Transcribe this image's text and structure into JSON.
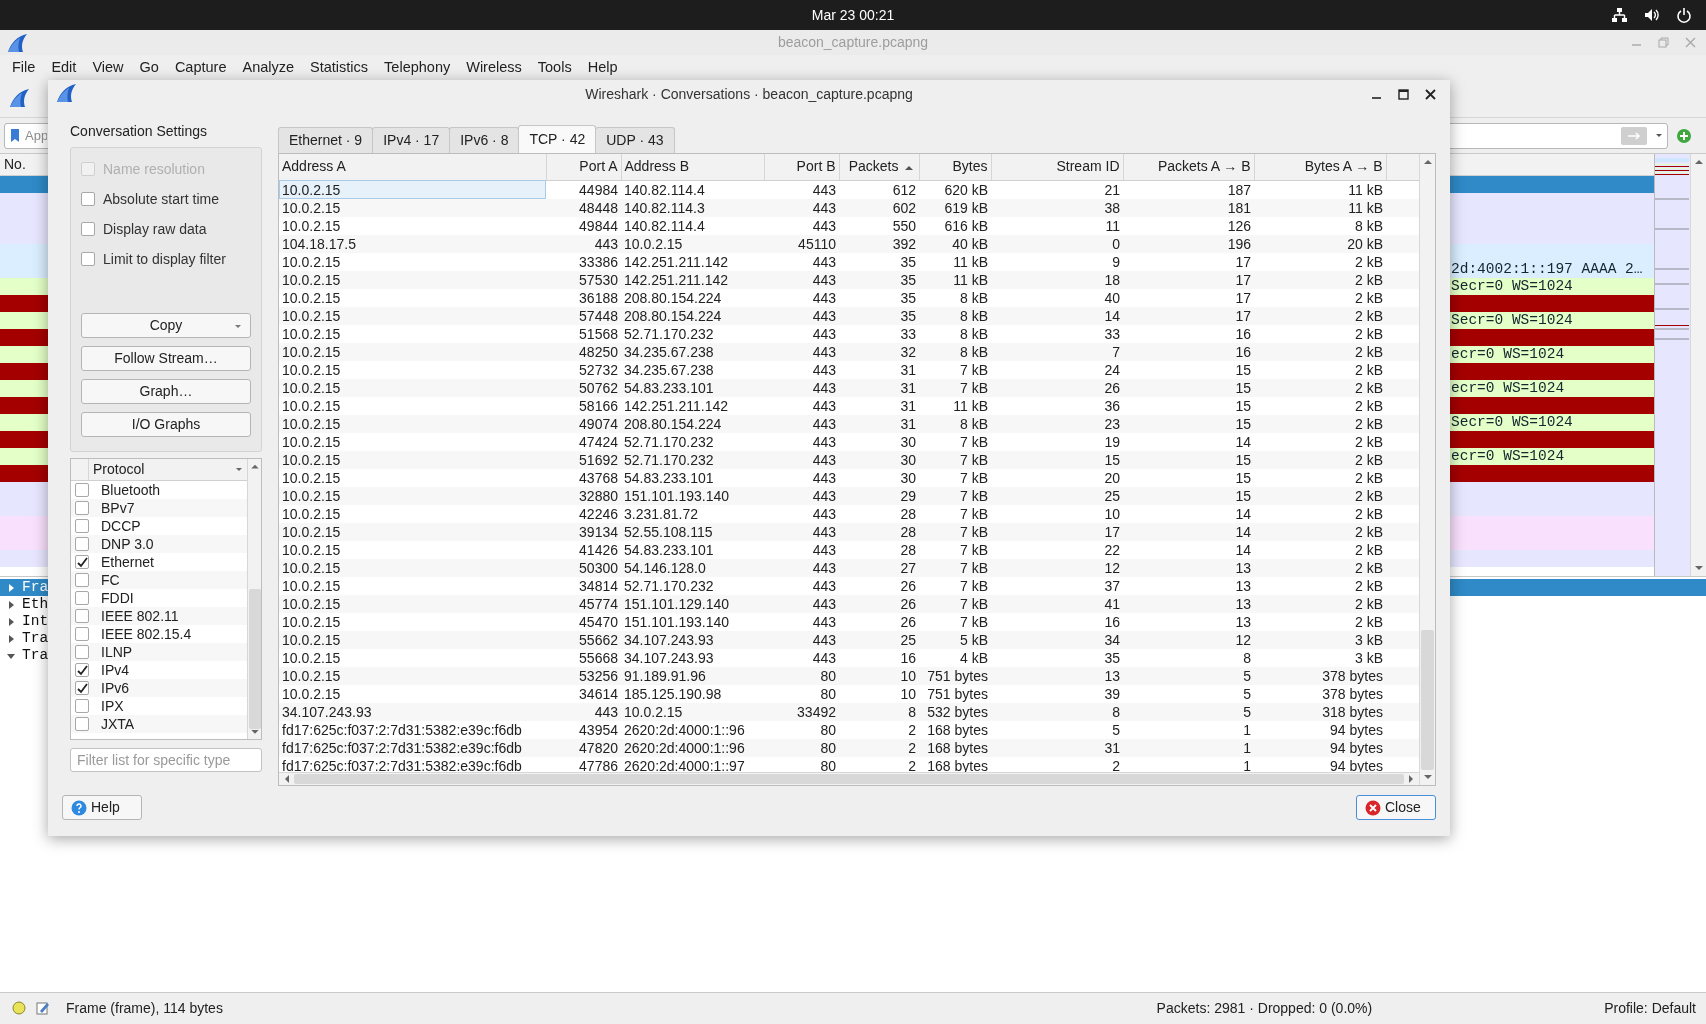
{
  "system_bar": {
    "clock": "Mar 23  00:21"
  },
  "main_window": {
    "title": "beacon_capture.pcapng",
    "menu": [
      "File",
      "Edit",
      "View",
      "Go",
      "Capture",
      "Analyze",
      "Statistics",
      "Telephony",
      "Wireless",
      "Tools",
      "Help"
    ],
    "filter": {
      "placeholder": "App"
    },
    "packet_list": {
      "column_1": "No.",
      "rows": [
        {
          "selected": true
        },
        {
          "selected": false,
          "color": "#e7e6ff"
        },
        {
          "selected": false,
          "color": "#e7e6ff"
        },
        {
          "selected": false,
          "color": "#e7e6ff"
        },
        {
          "selected": false,
          "color": "#daeeff"
        },
        {
          "selected": false,
          "color": "#daeeff",
          "text": "2d:4002:1::197 AAAA 2…"
        },
        {
          "selected": false,
          "color": "#e4ffc7",
          "text": "Secr=0 WS=1024"
        },
        {
          "selected": false,
          "color": "#a40000"
        },
        {
          "selected": false,
          "color": "#e4ffc7",
          "text": "Secr=0 WS=1024"
        },
        {
          "selected": false,
          "color": "#a40000"
        },
        {
          "selected": false,
          "color": "#e4ffc7",
          "text": "ecr=0 WS=1024"
        },
        {
          "selected": false,
          "color": "#a40000"
        },
        {
          "selected": false,
          "color": "#e4ffc7",
          "text": "ecr=0 WS=1024"
        },
        {
          "selected": false,
          "color": "#a40000"
        },
        {
          "selected": false,
          "color": "#e4ffc7",
          "text": "Secr=0 WS=1024"
        },
        {
          "selected": false,
          "color": "#a40000"
        },
        {
          "selected": false,
          "color": "#e4ffc7",
          "text": "ecr=0 WS=1024"
        },
        {
          "selected": false,
          "color": "#a40000"
        },
        {
          "selected": false,
          "color": "#e7e6ff"
        },
        {
          "selected": false,
          "color": "#e7e6ff"
        },
        {
          "selected": false,
          "color": "#f9e0fc"
        },
        {
          "selected": false,
          "color": "#f9e0fc"
        },
        {
          "selected": false,
          "color": "#e7e6ff"
        }
      ]
    },
    "details": [
      {
        "label": "Fra",
        "selected": true,
        "expanded": false
      },
      {
        "label": "Eth",
        "selected": false,
        "expanded": false
      },
      {
        "label": "Int",
        "selected": false,
        "expanded": false
      },
      {
        "label": "Tra",
        "selected": false,
        "expanded": false
      },
      {
        "label": "Tra",
        "selected": false,
        "expanded": true
      }
    ]
  },
  "dialog": {
    "title": "Wireshark · Conversations · beacon_capture.pcapng",
    "settings_title": "Conversation Settings",
    "options": [
      {
        "label": "Name resolution",
        "checked": false,
        "disabled": true
      },
      {
        "label": "Absolute start time",
        "checked": false,
        "disabled": false
      },
      {
        "label": "Display raw data",
        "checked": false,
        "disabled": false
      },
      {
        "label": "Limit to display filter",
        "checked": false,
        "disabled": false
      }
    ],
    "buttons": [
      {
        "label": "Copy",
        "kind": "menu"
      },
      {
        "label": "Follow Stream…",
        "kind": "plain"
      },
      {
        "label": "Graph…",
        "kind": "plain"
      },
      {
        "label": "I/O Graphs",
        "kind": "plain"
      }
    ],
    "protocol_header": "Protocol",
    "protocols": [
      {
        "label": "Bluetooth",
        "checked": false
      },
      {
        "label": "BPv7",
        "checked": false
      },
      {
        "label": "DCCP",
        "checked": false
      },
      {
        "label": "DNP 3.0",
        "checked": false
      },
      {
        "label": "Ethernet",
        "checked": true
      },
      {
        "label": "FC",
        "checked": false
      },
      {
        "label": "FDDI",
        "checked": false
      },
      {
        "label": "IEEE 802.11",
        "checked": false
      },
      {
        "label": "IEEE 802.15.4",
        "checked": false
      },
      {
        "label": "ILNP",
        "checked": false
      },
      {
        "label": "IPv4",
        "checked": true
      },
      {
        "label": "IPv6",
        "checked": true
      },
      {
        "label": "IPX",
        "checked": false
      },
      {
        "label": "JXTA",
        "checked": false
      }
    ],
    "filter_placeholder": "Filter list for specific type",
    "tabs": [
      {
        "label": "Ethernet · 9",
        "selected": false
      },
      {
        "label": "IPv4 · 17",
        "selected": false
      },
      {
        "label": "IPv6 · 8",
        "selected": false
      },
      {
        "label": "TCP · 42",
        "selected": true
      },
      {
        "label": "UDP · 43",
        "selected": false
      }
    ],
    "table": {
      "columns": [
        {
          "label": "Address A",
          "kind": "address",
          "sorted": false
        },
        {
          "label": "Port A",
          "kind": "number",
          "sorted": false
        },
        {
          "label": "Address B",
          "kind": "address",
          "sorted": false
        },
        {
          "label": "Port B",
          "kind": "number",
          "sorted": false
        },
        {
          "label": "Packets",
          "kind": "number",
          "sorted": true
        },
        {
          "label": "Bytes",
          "kind": "number",
          "sorted": false
        },
        {
          "label": "Stream ID",
          "kind": "number",
          "sorted": false
        },
        {
          "label": "Packets A → B",
          "kind": "number",
          "sorted": false
        },
        {
          "label": "Bytes A → B",
          "kind": "number",
          "sorted": false
        }
      ],
      "rows": [
        {
          "current": true,
          "cells": [
            "10.0.2.15",
            "44984",
            "140.82.114.4",
            "443",
            "612",
            "620 kB",
            "21",
            "187",
            "11 kB"
          ]
        },
        {
          "current": false,
          "cells": [
            "10.0.2.15",
            "48448",
            "140.82.114.3",
            "443",
            "602",
            "619 kB",
            "38",
            "181",
            "11 kB"
          ]
        },
        {
          "current": false,
          "cells": [
            "10.0.2.15",
            "49844",
            "140.82.114.4",
            "443",
            "550",
            "616 kB",
            "11",
            "126",
            "8 kB"
          ]
        },
        {
          "current": false,
          "cells": [
            "104.18.17.5",
            "443",
            "10.0.2.15",
            "45110",
            "392",
            "40 kB",
            "0",
            "196",
            "20 kB"
          ]
        },
        {
          "current": false,
          "cells": [
            "10.0.2.15",
            "33386",
            "142.251.211.142",
            "443",
            "35",
            "11 kB",
            "9",
            "17",
            "2 kB"
          ]
        },
        {
          "current": false,
          "cells": [
            "10.0.2.15",
            "57530",
            "142.251.211.142",
            "443",
            "35",
            "11 kB",
            "18",
            "17",
            "2 kB"
          ]
        },
        {
          "current": false,
          "cells": [
            "10.0.2.15",
            "36188",
            "208.80.154.224",
            "443",
            "35",
            "8 kB",
            "40",
            "17",
            "2 kB"
          ]
        },
        {
          "current": false,
          "cells": [
            "10.0.2.15",
            "57448",
            "208.80.154.224",
            "443",
            "35",
            "8 kB",
            "14",
            "17",
            "2 kB"
          ]
        },
        {
          "current": false,
          "cells": [
            "10.0.2.15",
            "51568",
            "52.71.170.232",
            "443",
            "33",
            "8 kB",
            "33",
            "16",
            "2 kB"
          ]
        },
        {
          "current": false,
          "cells": [
            "10.0.2.15",
            "48250",
            "34.235.67.238",
            "443",
            "32",
            "8 kB",
            "7",
            "16",
            "2 kB"
          ]
        },
        {
          "current": false,
          "cells": [
            "10.0.2.15",
            "52732",
            "34.235.67.238",
            "443",
            "31",
            "7 kB",
            "24",
            "15",
            "2 kB"
          ]
        },
        {
          "current": false,
          "cells": [
            "10.0.2.15",
            "50762",
            "54.83.233.101",
            "443",
            "31",
            "7 kB",
            "26",
            "15",
            "2 kB"
          ]
        },
        {
          "current": false,
          "cells": [
            "10.0.2.15",
            "58166",
            "142.251.211.142",
            "443",
            "31",
            "11 kB",
            "36",
            "15",
            "2 kB"
          ]
        },
        {
          "current": false,
          "cells": [
            "10.0.2.15",
            "49074",
            "208.80.154.224",
            "443",
            "31",
            "8 kB",
            "23",
            "15",
            "2 kB"
          ]
        },
        {
          "current": false,
          "cells": [
            "10.0.2.15",
            "47424",
            "52.71.170.232",
            "443",
            "30",
            "7 kB",
            "19",
            "14",
            "2 kB"
          ]
        },
        {
          "current": false,
          "cells": [
            "10.0.2.15",
            "51692",
            "52.71.170.232",
            "443",
            "30",
            "7 kB",
            "15",
            "15",
            "2 kB"
          ]
        },
        {
          "current": false,
          "cells": [
            "10.0.2.15",
            "43768",
            "54.83.233.101",
            "443",
            "30",
            "7 kB",
            "20",
            "15",
            "2 kB"
          ]
        },
        {
          "current": false,
          "cells": [
            "10.0.2.15",
            "32880",
            "151.101.193.140",
            "443",
            "29",
            "7 kB",
            "25",
            "15",
            "2 kB"
          ]
        },
        {
          "current": false,
          "cells": [
            "10.0.2.15",
            "42246",
            "3.231.81.72",
            "443",
            "28",
            "7 kB",
            "10",
            "14",
            "2 kB"
          ]
        },
        {
          "current": false,
          "cells": [
            "10.0.2.15",
            "39134",
            "52.55.108.115",
            "443",
            "28",
            "7 kB",
            "17",
            "14",
            "2 kB"
          ]
        },
        {
          "current": false,
          "cells": [
            "10.0.2.15",
            "41426",
            "54.83.233.101",
            "443",
            "28",
            "7 kB",
            "22",
            "14",
            "2 kB"
          ]
        },
        {
          "current": false,
          "cells": [
            "10.0.2.15",
            "50300",
            "54.146.128.0",
            "443",
            "27",
            "7 kB",
            "12",
            "13",
            "2 kB"
          ]
        },
        {
          "current": false,
          "cells": [
            "10.0.2.15",
            "34814",
            "52.71.170.232",
            "443",
            "26",
            "7 kB",
            "37",
            "13",
            "2 kB"
          ]
        },
        {
          "current": false,
          "cells": [
            "10.0.2.15",
            "45774",
            "151.101.129.140",
            "443",
            "26",
            "7 kB",
            "41",
            "13",
            "2 kB"
          ]
        },
        {
          "current": false,
          "cells": [
            "10.0.2.15",
            "45470",
            "151.101.193.140",
            "443",
            "26",
            "7 kB",
            "16",
            "13",
            "2 kB"
          ]
        },
        {
          "current": false,
          "cells": [
            "10.0.2.15",
            "55662",
            "34.107.243.93",
            "443",
            "25",
            "5 kB",
            "34",
            "12",
            "3 kB"
          ]
        },
        {
          "current": false,
          "cells": [
            "10.0.2.15",
            "55668",
            "34.107.243.93",
            "443",
            "16",
            "4 kB",
            "35",
            "8",
            "3 kB"
          ]
        },
        {
          "current": false,
          "cells": [
            "10.0.2.15",
            "53256",
            "91.189.91.96",
            "80",
            "10",
            "751 bytes",
            "13",
            "5",
            "378 bytes"
          ]
        },
        {
          "current": false,
          "cells": [
            "10.0.2.15",
            "34614",
            "185.125.190.98",
            "80",
            "10",
            "751 bytes",
            "39",
            "5",
            "378 bytes"
          ]
        },
        {
          "current": false,
          "cells": [
            "34.107.243.93",
            "443",
            "10.0.2.15",
            "33492",
            "8",
            "532 bytes",
            "8",
            "5",
            "318 bytes"
          ]
        },
        {
          "current": false,
          "cells": [
            "fd17:625c:f037:2:7d31:5382:e39c:f6db",
            "43954",
            "2620:2d:4000:1::96",
            "80",
            "2",
            "168 bytes",
            "5",
            "1",
            "94 bytes"
          ]
        },
        {
          "current": false,
          "cells": [
            "fd17:625c:f037:2:7d31:5382:e39c:f6db",
            "47820",
            "2620:2d:4000:1::96",
            "80",
            "2",
            "168 bytes",
            "31",
            "1",
            "94 bytes"
          ]
        },
        {
          "current": false,
          "cells": [
            "fd17:625c:f037:2:7d31:5382:e39c:f6db",
            "47786",
            "2620:2d:4000:1::97",
            "80",
            "2",
            "168 bytes",
            "2",
            "1",
            "94 bytes"
          ]
        }
      ]
    },
    "help_button": "Help",
    "close_button": "Close"
  },
  "status_bar": {
    "frame": "Frame (frame), 114 bytes",
    "packets": "Packets: 2981 · Dropped: 0 (0.0%)",
    "profile": "Profile: Default"
  }
}
